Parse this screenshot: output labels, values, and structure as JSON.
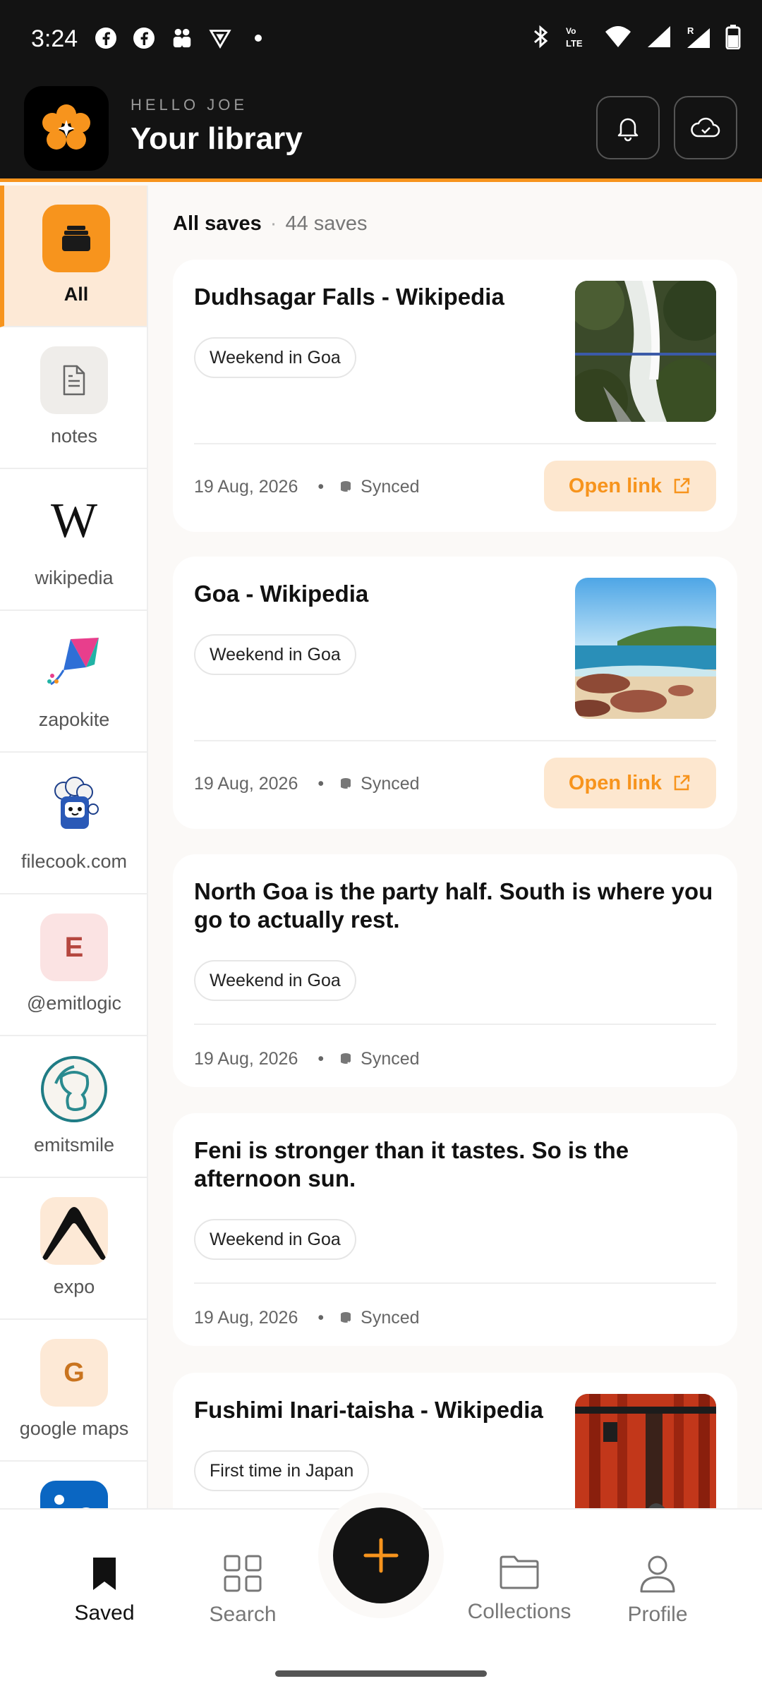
{
  "status_bar": {
    "time": "3:24"
  },
  "header": {
    "greeting": "HELLO JOE",
    "title": "Your library",
    "accent_color": "#f7941d"
  },
  "sidebar": {
    "items": [
      {
        "label": "All",
        "icon": "stack-icon",
        "active": true
      },
      {
        "label": "notes",
        "icon": "document-icon"
      },
      {
        "label": "wikipedia",
        "icon": "wikipedia-logo"
      },
      {
        "label": "zapokite",
        "icon": "kite-logo"
      },
      {
        "label": "filecook.com",
        "icon": "chef-logo"
      },
      {
        "label": "@emitlogic",
        "icon": "letter-e",
        "initial": "E"
      },
      {
        "label": "emitsmile",
        "icon": "face-logo"
      },
      {
        "label": "expo",
        "icon": "expo-logo"
      },
      {
        "label": "google maps",
        "icon": "letter-g",
        "initial": "G"
      },
      {
        "label": "",
        "icon": "linkedin-logo"
      }
    ]
  },
  "summary": {
    "label": "All saves",
    "count": "44 saves"
  },
  "cards": [
    {
      "title": "Dudhsagar Falls - Wikipedia",
      "tag": "Weekend in Goa",
      "date": "19 Aug, 2026",
      "status": "Synced",
      "action": "Open link",
      "thumb": "waterfall"
    },
    {
      "title": "Goa - Wikipedia",
      "tag": "Weekend in Goa",
      "date": "19 Aug, 2026",
      "status": "Synced",
      "action": "Open link",
      "thumb": "beach"
    },
    {
      "title": "North Goa is the party half. South is where you go to actually rest.",
      "tag": "Weekend in Goa",
      "date": "19 Aug, 2026",
      "status": "Synced"
    },
    {
      "title": "Feni is stronger than it tastes. So is the afternoon sun.",
      "tag": "Weekend in Goa",
      "date": "19 Aug, 2026",
      "status": "Synced"
    },
    {
      "title": "Fushimi Inari-taisha - Wikipedia",
      "tag": "First time in Japan",
      "thumb": "torii"
    }
  ],
  "bottom_nav": {
    "items": [
      {
        "label": "Saved",
        "icon": "bookmark-icon",
        "active": true
      },
      {
        "label": "Search",
        "icon": "grid-icon"
      },
      {
        "label": "Collections",
        "icon": "folder-icon"
      },
      {
        "label": "Profile",
        "icon": "person-icon"
      }
    ],
    "fab_icon": "plus-icon"
  }
}
